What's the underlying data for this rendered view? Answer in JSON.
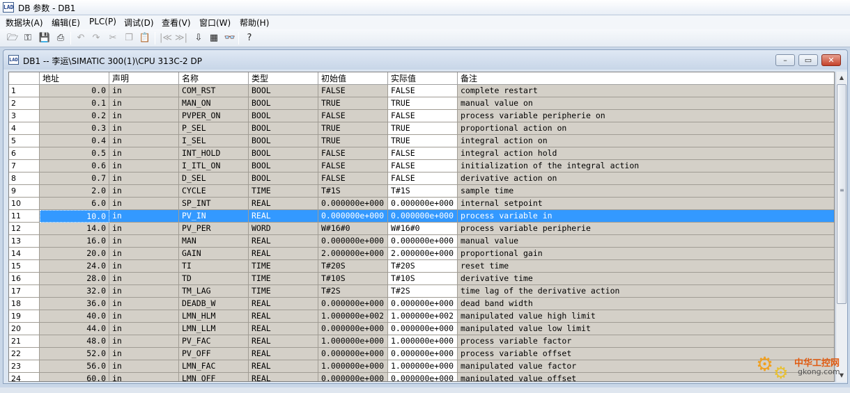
{
  "window": {
    "title": "DB 参数 - DB1",
    "icon_text": "LAD"
  },
  "menu": [
    "数据块(A)",
    "编辑(E)",
    "PLC(P)",
    "调试(D)",
    "查看(V)",
    "窗口(W)",
    "帮助(H)"
  ],
  "toolbar": [
    {
      "name": "new-icon",
      "glyph": "🗁",
      "enabled": true
    },
    {
      "name": "open-online-icon",
      "glyph": "⚿",
      "enabled": true
    },
    {
      "name": "save-icon",
      "glyph": "💾",
      "enabled": true
    },
    {
      "name": "print-icon",
      "glyph": "⎙",
      "enabled": true
    },
    {
      "name": "undo-icon",
      "glyph": "↶",
      "enabled": false
    },
    {
      "name": "redo-icon",
      "glyph": "↷",
      "enabled": false
    },
    {
      "name": "cut-icon",
      "glyph": "✂",
      "enabled": false
    },
    {
      "name": "copy-icon",
      "glyph": "❐",
      "enabled": false
    },
    {
      "name": "paste-icon",
      "glyph": "📋",
      "enabled": false
    },
    {
      "name": "first-icon",
      "glyph": "|≪",
      "enabled": false
    },
    {
      "name": "last-icon",
      "glyph": "≫|",
      "enabled": false
    },
    {
      "name": "download-icon",
      "glyph": "⇩",
      "enabled": true
    },
    {
      "name": "modules-icon",
      "glyph": "▦",
      "enabled": true
    },
    {
      "name": "monitor-icon",
      "glyph": "👓",
      "enabled": true
    },
    {
      "name": "help-icon",
      "glyph": "?",
      "enabled": true
    }
  ],
  "child_window": {
    "title": "DB1 -- 李运\\SIMATIC 300(1)\\CPU 313C-2 DP",
    "icon_text": "LAD",
    "minimize": "–",
    "maximize": "▭",
    "close": "✕"
  },
  "columns": [
    "地址",
    "声明",
    "名称",
    "类型",
    "初始值",
    "实际值",
    "备注"
  ],
  "rows": [
    {
      "num": "1",
      "addr": "0.0",
      "decl": "in",
      "name": "COM_RST",
      "type": "BOOL",
      "init": "FALSE",
      "actual": "FALSE",
      "comment": "complete restart"
    },
    {
      "num": "2",
      "addr": "0.1",
      "decl": "in",
      "name": "MAN_ON",
      "type": "BOOL",
      "init": "TRUE",
      "actual": "TRUE",
      "comment": "manual value on"
    },
    {
      "num": "3",
      "addr": "0.2",
      "decl": "in",
      "name": "PVPER_ON",
      "type": "BOOL",
      "init": "FALSE",
      "actual": "FALSE",
      "comment": "process variable peripherie on"
    },
    {
      "num": "4",
      "addr": "0.3",
      "decl": "in",
      "name": "P_SEL",
      "type": "BOOL",
      "init": "TRUE",
      "actual": "TRUE",
      "comment": "proportional action on"
    },
    {
      "num": "5",
      "addr": "0.4",
      "decl": "in",
      "name": "I_SEL",
      "type": "BOOL",
      "init": "TRUE",
      "actual": "TRUE",
      "comment": "integral action on"
    },
    {
      "num": "6",
      "addr": "0.5",
      "decl": "in",
      "name": "INT_HOLD",
      "type": "BOOL",
      "init": "FALSE",
      "actual": "FALSE",
      "comment": "integral action hold"
    },
    {
      "num": "7",
      "addr": "0.6",
      "decl": "in",
      "name": "I_ITL_ON",
      "type": "BOOL",
      "init": "FALSE",
      "actual": "FALSE",
      "comment": "initialization of the integral action"
    },
    {
      "num": "8",
      "addr": "0.7",
      "decl": "in",
      "name": "D_SEL",
      "type": "BOOL",
      "init": "FALSE",
      "actual": "FALSE",
      "comment": "derivative action on"
    },
    {
      "num": "9",
      "addr": "2.0",
      "decl": "in",
      "name": "CYCLE",
      "type": "TIME",
      "init": "T#1S",
      "actual": "T#1S",
      "comment": "sample time"
    },
    {
      "num": "10",
      "addr": "6.0",
      "decl": "in",
      "name": "SP_INT",
      "type": "REAL",
      "init": "0.000000e+000",
      "actual": "0.000000e+000",
      "comment": "internal setpoint"
    },
    {
      "num": "11",
      "addr": "10.0",
      "decl": "in",
      "name": "PV_IN",
      "type": "REAL",
      "init": "0.000000e+000",
      "actual": "0.000000e+000",
      "comment": "process variable in",
      "selected": true
    },
    {
      "num": "12",
      "addr": "14.0",
      "decl": "in",
      "name": "PV_PER",
      "type": "WORD",
      "init": "W#16#0",
      "actual": "W#16#0",
      "comment": "process variable peripherie"
    },
    {
      "num": "13",
      "addr": "16.0",
      "decl": "in",
      "name": "MAN",
      "type": "REAL",
      "init": "0.000000e+000",
      "actual": "0.000000e+000",
      "comment": "manual value"
    },
    {
      "num": "14",
      "addr": "20.0",
      "decl": "in",
      "name": "GAIN",
      "type": "REAL",
      "init": "2.000000e+000",
      "actual": "2.000000e+000",
      "comment": "proportional gain"
    },
    {
      "num": "15",
      "addr": "24.0",
      "decl": "in",
      "name": "TI",
      "type": "TIME",
      "init": "T#20S",
      "actual": "T#20S",
      "comment": "reset time"
    },
    {
      "num": "16",
      "addr": "28.0",
      "decl": "in",
      "name": "TD",
      "type": "TIME",
      "init": "T#10S",
      "actual": "T#10S",
      "comment": "derivative time"
    },
    {
      "num": "17",
      "addr": "32.0",
      "decl": "in",
      "name": "TM_LAG",
      "type": "TIME",
      "init": "T#2S",
      "actual": "T#2S",
      "comment": "time lag of the derivative action"
    },
    {
      "num": "18",
      "addr": "36.0",
      "decl": "in",
      "name": "DEADB_W",
      "type": "REAL",
      "init": "0.000000e+000",
      "actual": "0.000000e+000",
      "comment": "dead band width"
    },
    {
      "num": "19",
      "addr": "40.0",
      "decl": "in",
      "name": "LMN_HLM",
      "type": "REAL",
      "init": "1.000000e+002",
      "actual": "1.000000e+002",
      "comment": "manipulated value high limit"
    },
    {
      "num": "20",
      "addr": "44.0",
      "decl": "in",
      "name": "LMN_LLM",
      "type": "REAL",
      "init": "0.000000e+000",
      "actual": "0.000000e+000",
      "comment": "manipulated value low limit"
    },
    {
      "num": "21",
      "addr": "48.0",
      "decl": "in",
      "name": "PV_FAC",
      "type": "REAL",
      "init": "1.000000e+000",
      "actual": "1.000000e+000",
      "comment": "process variable factor"
    },
    {
      "num": "22",
      "addr": "52.0",
      "decl": "in",
      "name": "PV_OFF",
      "type": "REAL",
      "init": "0.000000e+000",
      "actual": "0.000000e+000",
      "comment": "process variable offset"
    },
    {
      "num": "23",
      "addr": "56.0",
      "decl": "in",
      "name": "LMN_FAC",
      "type": "REAL",
      "init": "1.000000e+000",
      "actual": "1.000000e+000",
      "comment": "manipulated value factor"
    },
    {
      "num": "24",
      "addr": "60.0",
      "decl": "in",
      "name": "LMN_OFF",
      "type": "REAL",
      "init": "0.000000e+000",
      "actual": "0.000000e+000",
      "comment": "manipulated value offset"
    }
  ],
  "watermark": {
    "title": "中华工控网",
    "sub": "gkong.com"
  },
  "colors": {
    "selection": "#3399ff",
    "grid_bg": "#d4d0c8",
    "close_button": "#c5422b"
  }
}
